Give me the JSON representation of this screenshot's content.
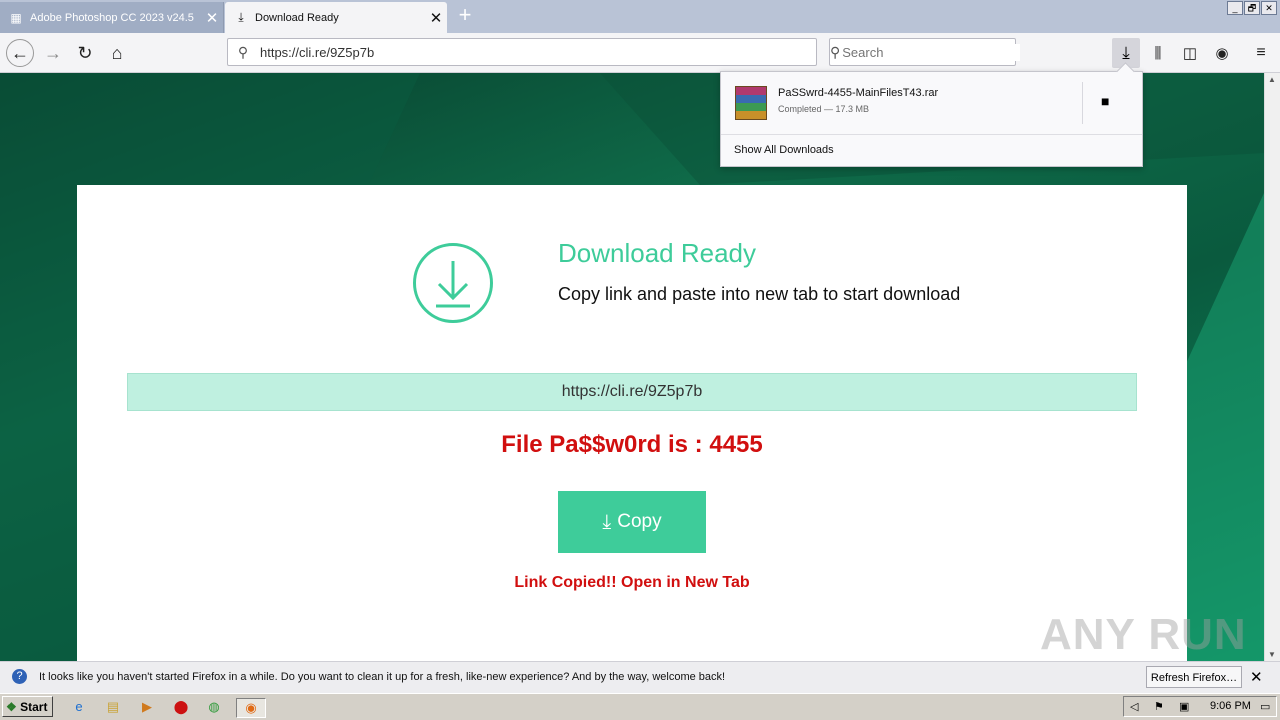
{
  "window": {
    "controls": [
      "_",
      "🗗",
      "✕"
    ]
  },
  "tabs": [
    {
      "title": "Adobe Photoshop CC 2023 v24.5",
      "close": "✕"
    },
    {
      "title": "Download Ready",
      "close": "✕"
    }
  ],
  "newtab_label": "+",
  "nav": {
    "url": "https://cli.re/9Z5p7b",
    "search_placeholder": "Search"
  },
  "page": {
    "title": "Download Ready",
    "subtitle": "Copy link and paste into new tab to start download",
    "link": "https://cli.re/9Z5p7b",
    "password": "File Pa$$w0rd is : 4455",
    "copy_label": "Copy",
    "copied_text": "Link Copied!! Open in New Tab",
    "accent": "#3ecc9a",
    "alert": "#d10f0f"
  },
  "downloads": {
    "file_name": "PaSSwrd-4455-MainFilesT43.rar",
    "status": "Completed — 17.3 MB",
    "show_all": "Show All Downloads"
  },
  "notification": {
    "message": "It looks like you haven't started Firefox in a while. Do you want to clean it up for a fresh, like-new experience? And by the way, welcome back!",
    "button": "Refresh Firefox…",
    "close": "✕"
  },
  "taskbar": {
    "start": "Start",
    "clock": "9:06 PM"
  },
  "watermark": "ANY RUN"
}
